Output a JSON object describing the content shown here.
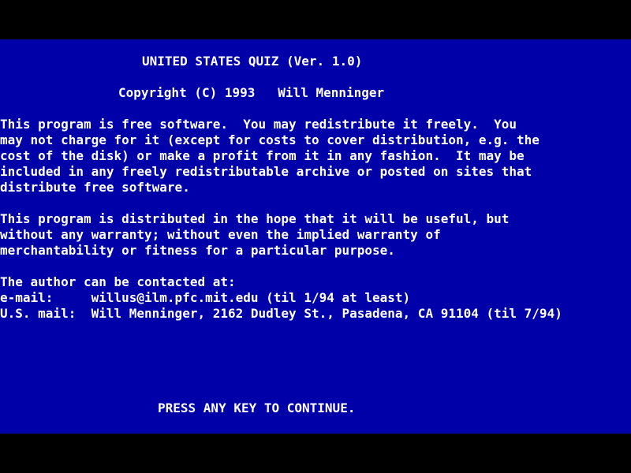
{
  "screen": {
    "title": "UNITED STATES QUIZ (Ver. 1.0)",
    "copyright": "Copyright (C) 1993   Will Menninger",
    "license_lines": [
      "This program is free software.  You may redistribute it freely.  You",
      "may not charge for it (except for costs to cover distribution, e.g. the",
      "cost of the disk) or make a profit from it in any fashion.  It may be",
      "included in any freely redistributable archive or posted on sites that",
      "distribute free software."
    ],
    "warranty_lines": [
      "This program is distributed in the hope that it will be useful, but",
      "without any warranty; without even the implied warranty of",
      "merchantability or fitness for a particular purpose."
    ],
    "contact_header": "The author can be contacted at:",
    "email_line": "e-mail:     willus@ilm.pfc.mit.edu (til 1/94 at least)",
    "mail_line": "U.S. mail:  Will Menninger, 2162 Dudley St., Pasadena, CA 91104 (til 7/94)",
    "prompt": "PRESS ANY KEY TO CONTINUE."
  },
  "colors": {
    "background": "#0000a8",
    "border": "#000000",
    "text": "#ffffff"
  }
}
